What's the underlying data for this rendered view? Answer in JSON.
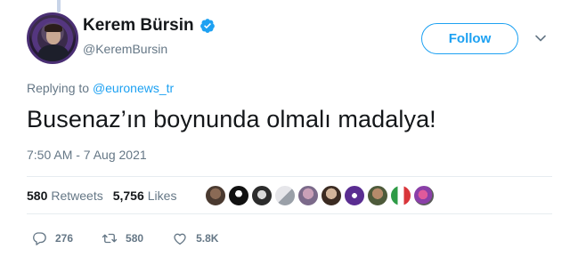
{
  "user": {
    "display_name": "Kerem Bürsin",
    "handle": "@KeremBursin",
    "verified_icon": "verified-badge-icon"
  },
  "follow_label": "Follow",
  "reply_context": {
    "prefix": "Replying to",
    "mention": "@euronews_tr"
  },
  "tweet_text": "Busenaz’ın boynunda olmalı madalya!",
  "timestamp": "7:50 AM - 7 Aug 2021",
  "stats": {
    "retweets_count": "580",
    "retweets_label": "Retweets",
    "likes_count": "5,756",
    "likes_label": "Likes"
  },
  "actions": {
    "reply_count": "276",
    "retweet_count": "580",
    "like_count": "5.8K"
  },
  "colors": {
    "accent": "#1da1f2",
    "secondary_text": "#657786",
    "primary_text": "#14171a",
    "divider": "#e6ecf0"
  }
}
